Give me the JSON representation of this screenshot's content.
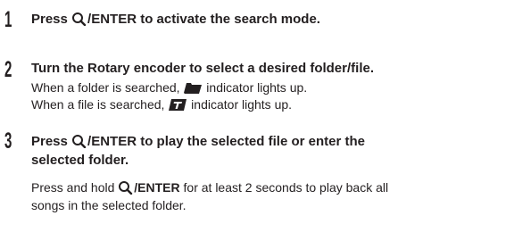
{
  "steps": [
    {
      "number": "1",
      "pre": "Press",
      "key": "/ENTER",
      "post": " to activate the search mode."
    },
    {
      "number": "2",
      "pre": "Turn the ",
      "bold": "Rotary encoder",
      "post": " to select a desired folder/file.",
      "lines": [
        {
          "pre": "When a folder is searched, ",
          "post": " indicator lights up."
        },
        {
          "pre": "When a file is searched, ",
          "post": " indicator lights up."
        }
      ]
    },
    {
      "number": "3",
      "pre": "Press",
      "key": "/ENTER",
      "post": " to play the selected file or enter the",
      "post2": "selected folder.",
      "line1_pre": "Press and hold",
      "line1_key": "/ENTER",
      "line1_post": " for at least 2 seconds to play back all",
      "line2": "songs in the selected folder."
    }
  ]
}
